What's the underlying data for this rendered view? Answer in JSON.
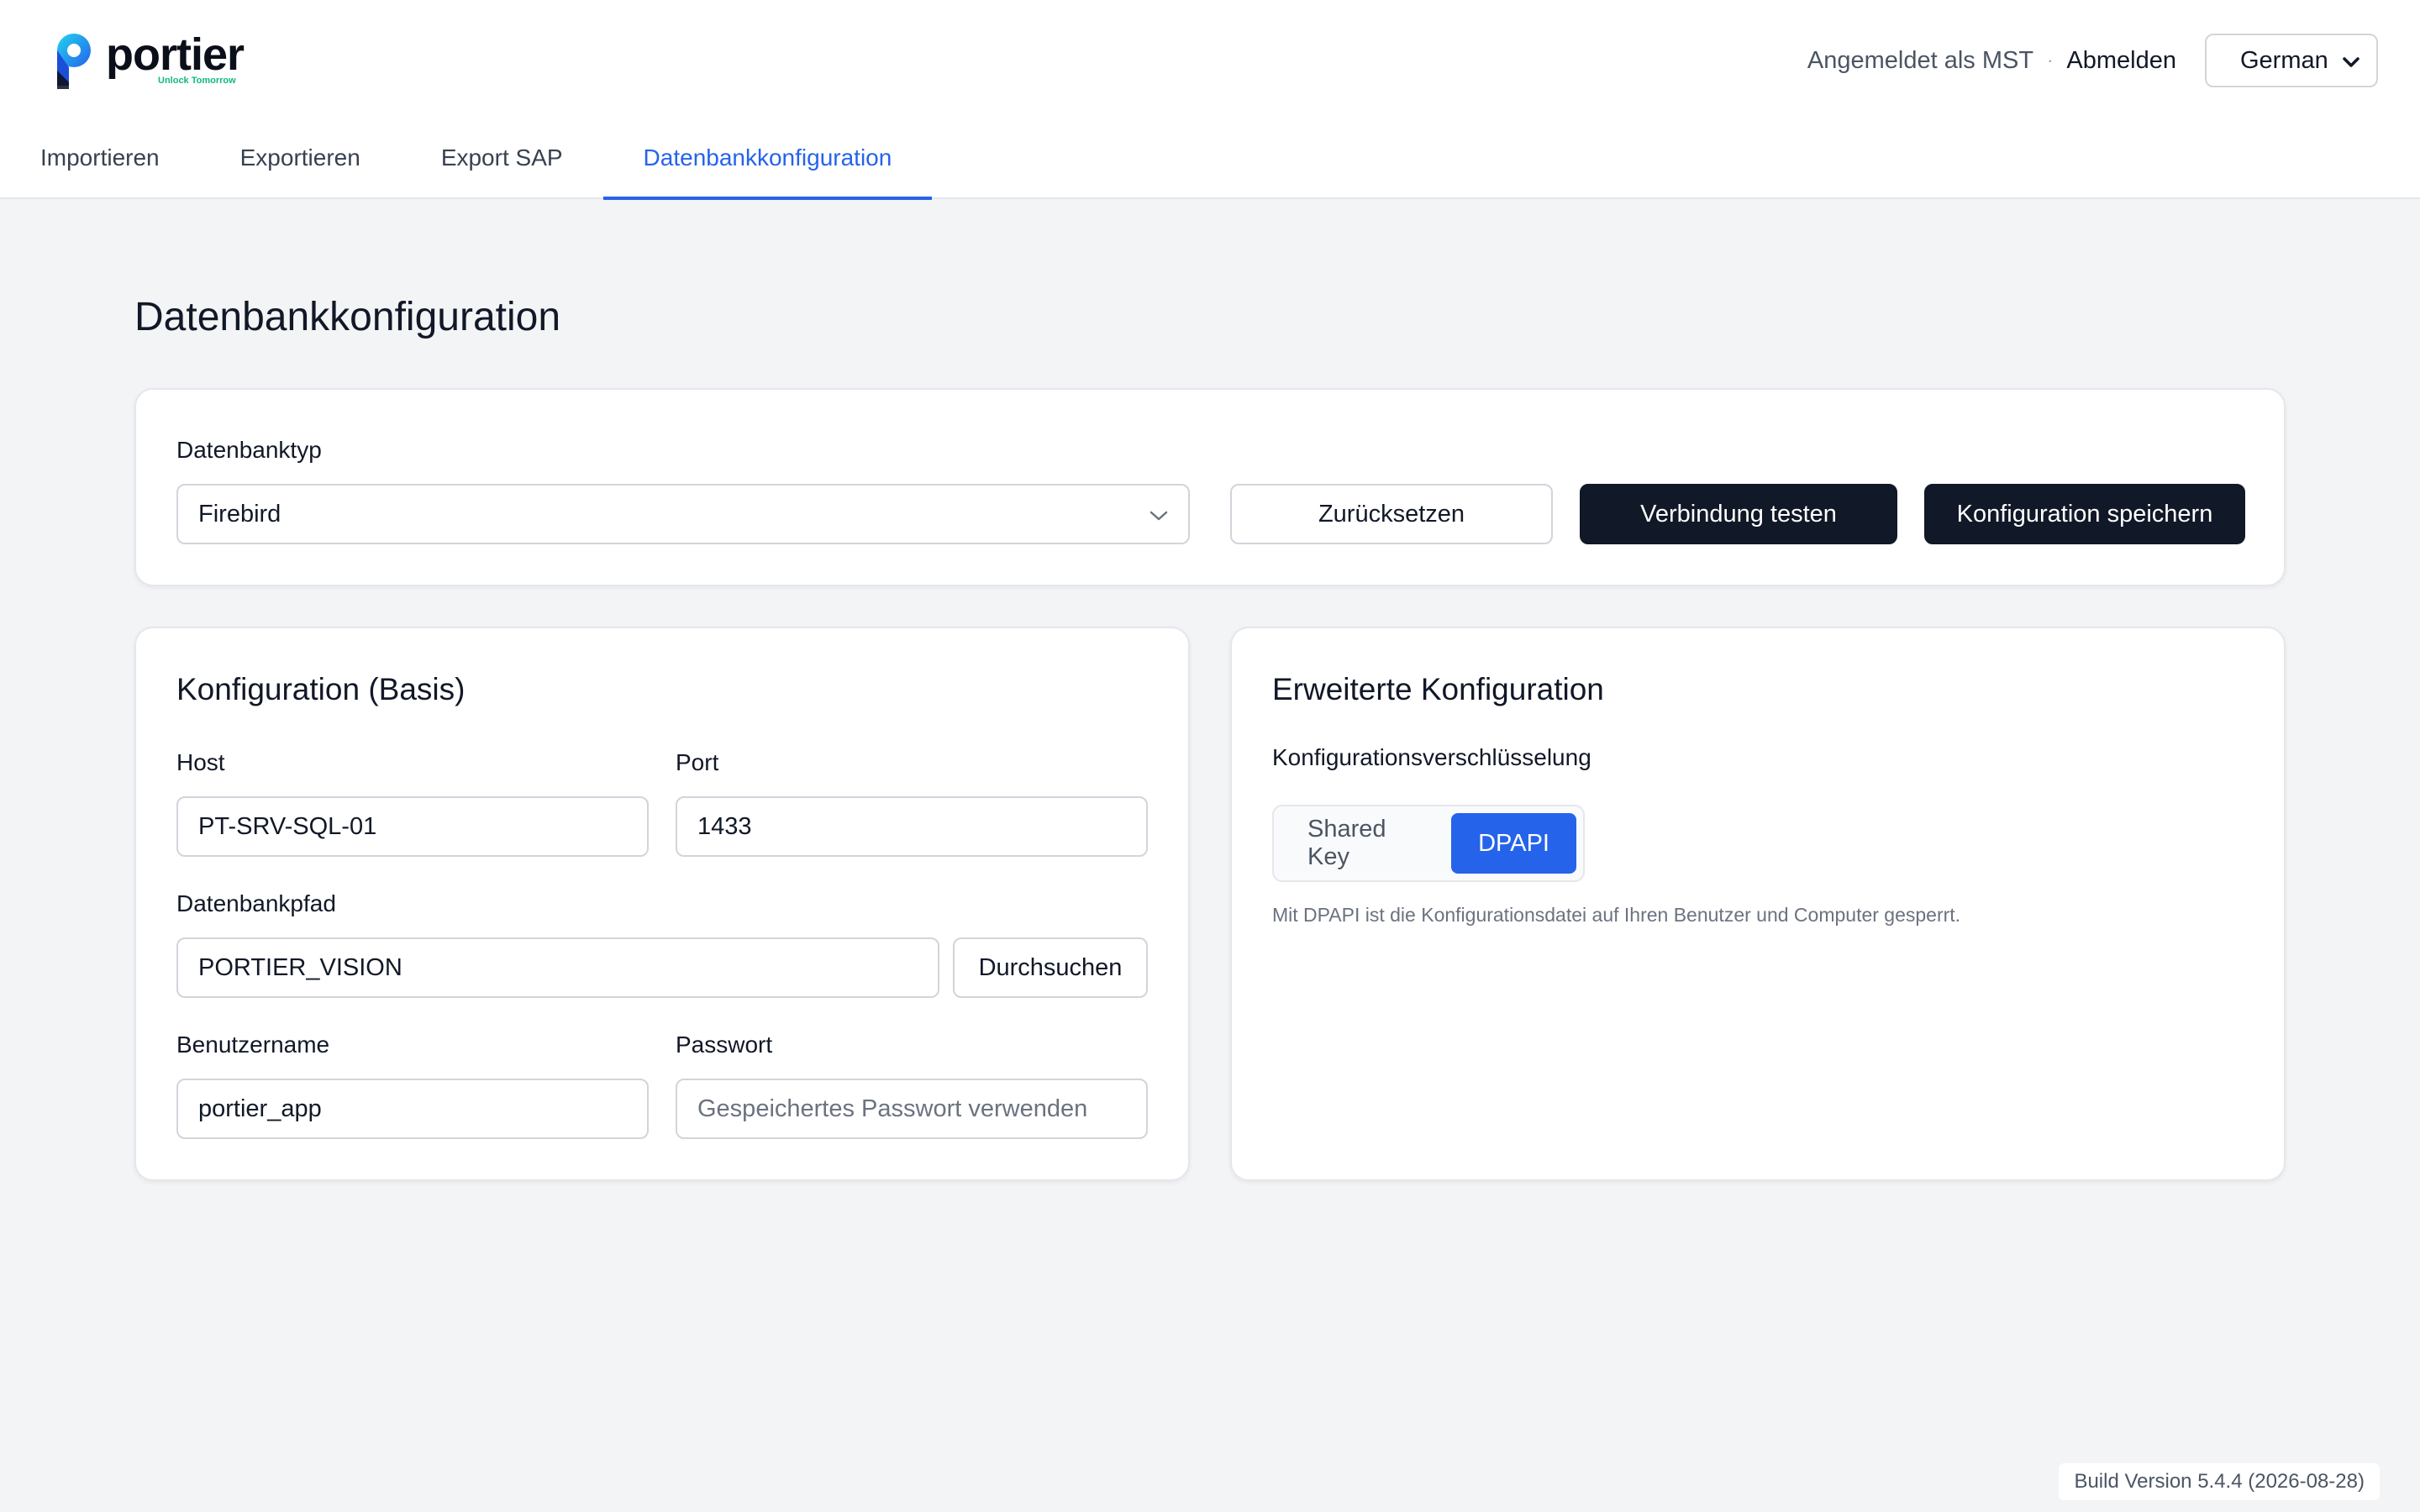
{
  "app": {
    "logo_text": "portier",
    "logo_tagline": "Unlock Tomorrow",
    "signed_in_text": "Angemeldet als MST",
    "separator": "·",
    "logout_label": "Abmelden",
    "language": "German"
  },
  "tabs": [
    {
      "label": "Importieren",
      "active": false
    },
    {
      "label": "Exportieren",
      "active": false
    },
    {
      "label": "Export SAP",
      "active": false
    },
    {
      "label": "Datenbankkonfiguration",
      "active": true
    }
  ],
  "page": {
    "title": "Datenbankkonfiguration"
  },
  "db_type": {
    "label": "Datenbanktyp",
    "value": "Firebird",
    "reset_label": "Zurücksetzen",
    "test_label": "Verbindung testen",
    "save_label": "Konfiguration speichern"
  },
  "basic": {
    "heading": "Konfiguration (Basis)",
    "host_label": "Host",
    "host_value": "PT-SRV-SQL-01",
    "port_label": "Port",
    "port_value": "1433",
    "path_label": "Datenbankpfad",
    "path_value": "PORTIER_VISION",
    "browse_label": "Durchsuchen",
    "user_label": "Benutzername",
    "user_value": "portier_app",
    "password_label": "Passwort",
    "password_placeholder": "Gespeichertes Passwort verwenden"
  },
  "advanced": {
    "heading": "Erweiterte Konfiguration",
    "encryption_label": "Konfigurationsverschlüsselung",
    "options": [
      {
        "label": "Shared Key",
        "active": false
      },
      {
        "label": "DPAPI",
        "active": true
      }
    ],
    "hint": "Mit DPAPI ist die Konfigurationsdatei auf Ihren Benutzer und Computer gesperrt."
  },
  "footer": {
    "build": "Build Version 5.4.4 (2026-08-28)"
  },
  "colors": {
    "accent": "#2563eb",
    "dark_button": "#111827",
    "background": "#f3f4f6"
  }
}
